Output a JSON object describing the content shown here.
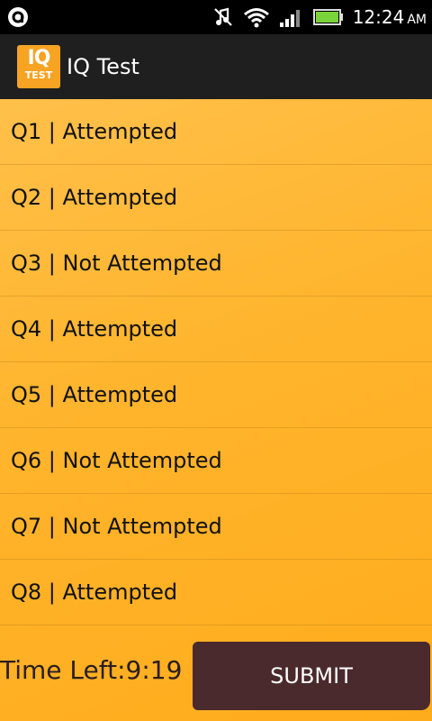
{
  "status_bar": {
    "time": "12:24",
    "ampm": "AM",
    "icons": [
      "app-notification-icon",
      "mute-icon",
      "wifi-icon",
      "signal-icon",
      "battery-icon"
    ],
    "battery_color": "#7bd33a"
  },
  "action_bar": {
    "logo_top": "IQ",
    "logo_bottom": "TEST",
    "title": "IQ Test"
  },
  "colors": {
    "background_accent": "#ffb52e",
    "submit_button": "#4a2a2c"
  },
  "questions": [
    "Q1 | Attempted",
    "Q2 | Attempted",
    "Q3 | Not Attempted",
    "Q4 | Attempted",
    "Q5 | Attempted",
    "Q6 | Not Attempted",
    "Q7 | Not Attempted",
    "Q8 | Attempted"
  ],
  "footer": {
    "time_left": "Time Left:9:19",
    "submit_label": "SUBMIT"
  }
}
